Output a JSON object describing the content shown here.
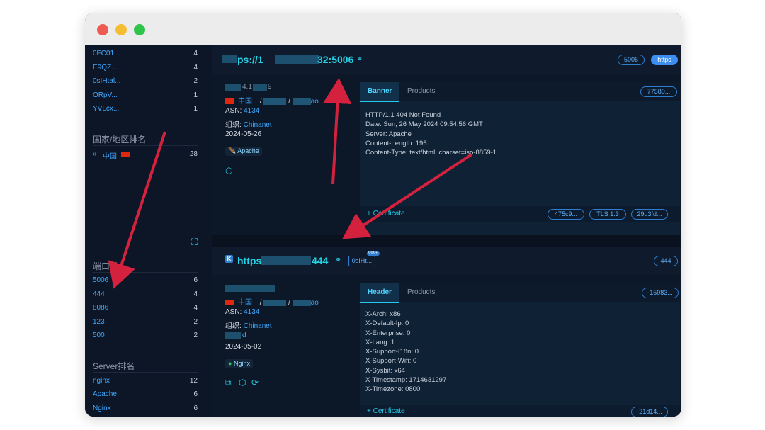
{
  "sidebar": {
    "top_items": [
      {
        "label": "0FC01...",
        "count": "4"
      },
      {
        "label": "E9QZ...",
        "count": "4"
      },
      {
        "label": "0sIHtal...",
        "count": "2"
      },
      {
        "label": "ORpV...",
        "count": "1"
      },
      {
        "label": "YVLcx...",
        "count": "1"
      }
    ],
    "country_title": "国家/地区排名",
    "country_items": [
      {
        "label": "中国",
        "count": "28"
      }
    ],
    "port_title": "端口排",
    "port_items": [
      {
        "label": "5006",
        "count": "6"
      },
      {
        "label": "444",
        "count": "4"
      },
      {
        "label": "8086",
        "count": "4"
      },
      {
        "label": "123",
        "count": "2"
      },
      {
        "label": "500",
        "count": "2"
      }
    ],
    "server_title": "Server排名",
    "server_items": [
      {
        "label": "nginx",
        "count": "12"
      },
      {
        "label": "Apache",
        "count": "6"
      },
      {
        "label": "Nginx",
        "count": "6"
      }
    ]
  },
  "result1": {
    "url_prefix": "ps://1",
    "url_suffix": "32:5006",
    "port_pill": "5006",
    "proto_pill": "https",
    "ip_partial": "4.1",
    "ip_tail": "9",
    "country": "中国",
    "sep1": "/",
    "sep2": "/",
    "city_tail": "ao",
    "asn_label": "ASN: ",
    "asn_value": "4134",
    "org_label": "组织: ",
    "org_value": "Chinanet",
    "date": "2024-05-26",
    "server_tag": "Apache",
    "tab_banner": "Banner",
    "tab_products": "Products",
    "hash_pill": "77580...",
    "banner": "HTTP/1.1 404 Not Found\nDate: Sun, 26 May 2024 09:54:56 GMT\nServer: Apache\nContent-Length: 196\nContent-Type: text/html; charset=iso-8859-1",
    "cert_label": "+ Certificate",
    "cert_pills": [
      "475c9...",
      "TLS 1.3",
      "29d3fd..."
    ]
  },
  "result2": {
    "k_icon": "K",
    "url_prefix": "https",
    "url_suffix": "444",
    "tag_pill": "0sIHt...",
    "tag_badge": "999+",
    "port_pill": "444",
    "country": "中国",
    "sep1": "/",
    "sep2": "/",
    "city_tail": "ao",
    "asn_label": "ASN: ",
    "asn_value": "4134",
    "org_label": "组织: ",
    "org_value": "Chinanet",
    "extra": "d",
    "date": "2024-05-02",
    "server_tag": "Nginx",
    "tab_header": "Header",
    "tab_products": "Products",
    "hash_pill": "-15983...",
    "header": "X-Arch: x86\nX-Default-Ip: 0\nX-Enterprise: 0\nX-Lang: 1\nX-Support-I18n: 0\nX-Support-Wifi: 0\nX-Sysbit: x64\nX-Timestamp: 1714631297\nX-Timezone: 0800",
    "cert_label": "+ Certificate",
    "cert_pill": "-21d14..."
  },
  "colors": {
    "accent": "#26d3e6",
    "link": "#3ea8ff",
    "arrow": "#d3213e",
    "background": "#0b1424"
  }
}
